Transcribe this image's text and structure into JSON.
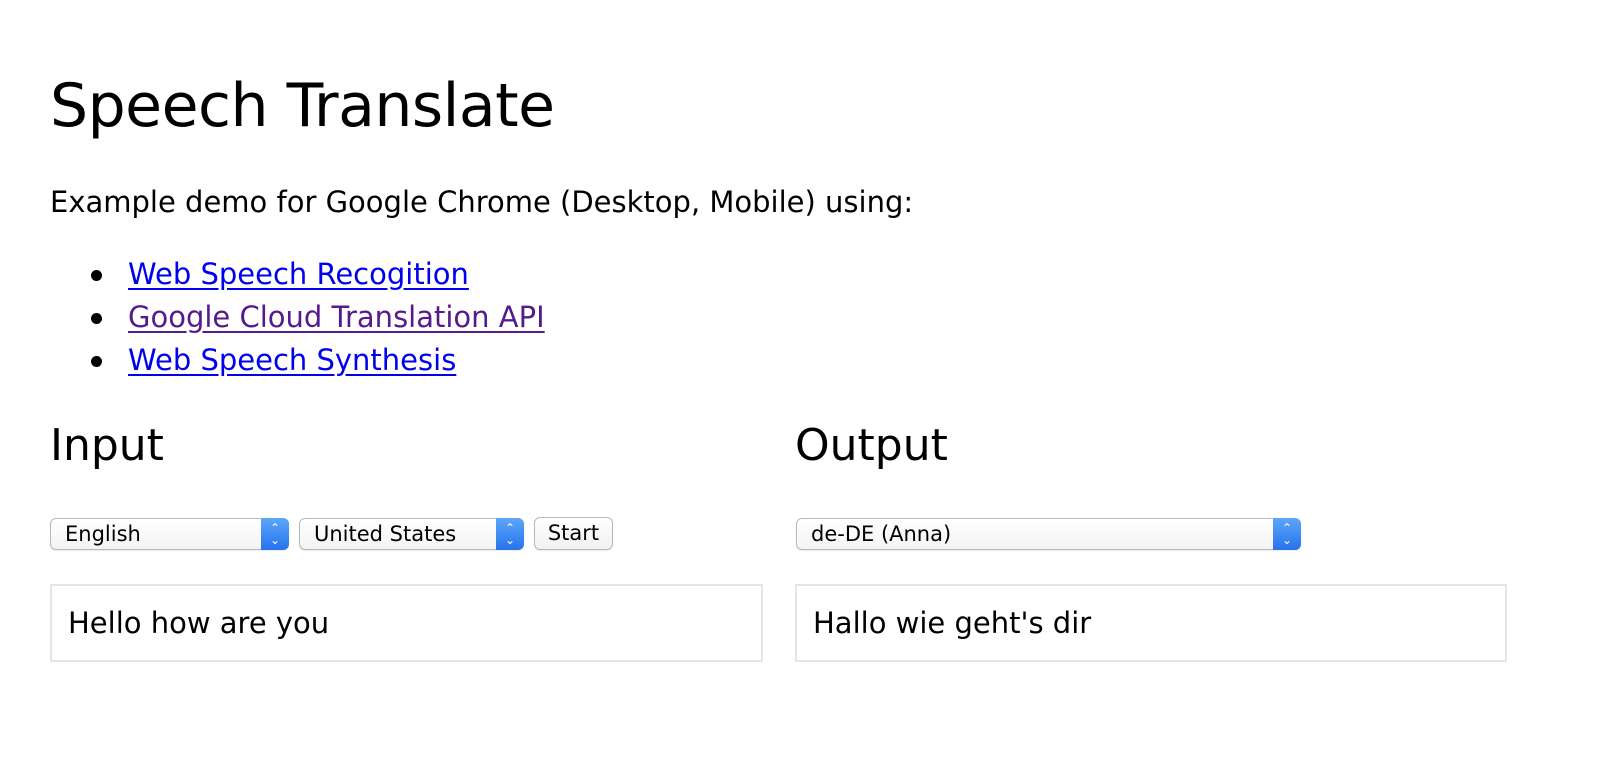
{
  "page": {
    "title": "Speech Translate",
    "intro": "Example demo for Google Chrome (Desktop, Mobile) using:",
    "links": [
      {
        "label": "Web Speech Recogition",
        "visited": false
      },
      {
        "label": "Google Cloud Translation API",
        "visited": true
      },
      {
        "label": "Web Speech Synthesis",
        "visited": false
      }
    ]
  },
  "input": {
    "heading": "Input",
    "language_select": "English",
    "country_select": "United States",
    "start_button": "Start",
    "text": "Hello how are you"
  },
  "output": {
    "heading": "Output",
    "voice_select": "de-DE (Anna)",
    "text": "Hallo wie geht's dir"
  },
  "colors": {
    "link": "#0000ee",
    "link_visited": "#551a8b",
    "select_arrow": "#2673ec",
    "textbox_border": "#e5e5e5"
  },
  "icons": {
    "select_arrow": "chevron-up-down-icon",
    "list_bullet": "bullet-icon"
  }
}
